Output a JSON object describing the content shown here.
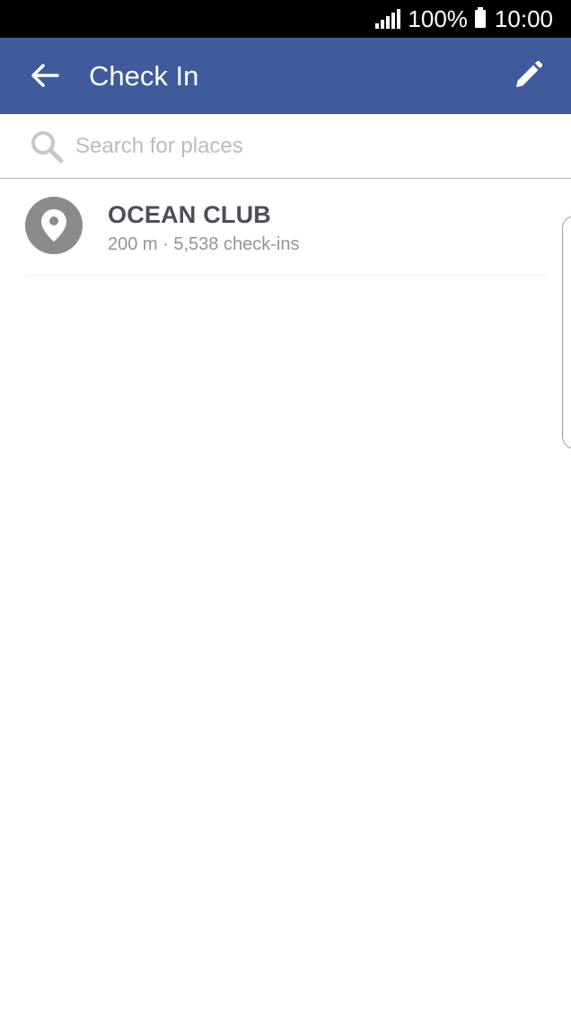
{
  "status_bar": {
    "battery_percent": "100%",
    "time": "10:00"
  },
  "app_bar": {
    "title": "Check In",
    "back_icon": "arrow-left-icon",
    "edit_icon": "pencil-icon"
  },
  "search": {
    "placeholder": "Search for places",
    "value": ""
  },
  "places": [
    {
      "name": "OCEAN CLUB",
      "meta": "200 m · 5,538 check-ins",
      "icon": "location-pin-icon"
    }
  ],
  "colors": {
    "app_bar": "#3f5b9c",
    "status_bar": "#000000",
    "avatar": "#8b8b8b",
    "place_name": "#4b4f58",
    "place_meta": "#90949c"
  }
}
